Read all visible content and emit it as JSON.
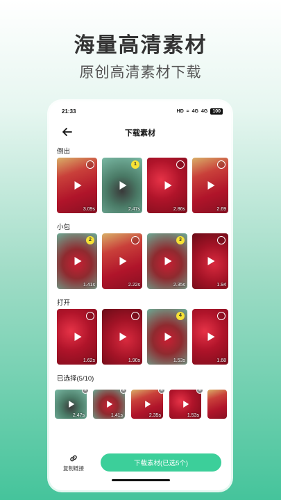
{
  "hero": {
    "title": "海量高清素材",
    "subtitle": "原创高清素材下载"
  },
  "status_bar": {
    "time": "21:33",
    "hd": "HD",
    "wifi": "≈",
    "sig1": "4G",
    "sig2": "4G",
    "battery": "100"
  },
  "nav": {
    "title": "下载素材",
    "back_icon": "arrow-left-icon"
  },
  "sections": [
    {
      "label": "倒出",
      "items": [
        {
          "duration": "3.09s",
          "selected": ""
        },
        {
          "duration": "2.47s",
          "selected": "1"
        },
        {
          "duration": "2.86s",
          "selected": ""
        },
        {
          "duration": "2.69",
          "selected": ""
        }
      ]
    },
    {
      "label": "小包",
      "items": [
        {
          "duration": "1.41s",
          "selected": "2"
        },
        {
          "duration": "2.22s",
          "selected": ""
        },
        {
          "duration": "2.35s",
          "selected": "3"
        },
        {
          "duration": "1.94",
          "selected": ""
        }
      ]
    },
    {
      "label": "打开",
      "items": [
        {
          "duration": "1.62s",
          "selected": ""
        },
        {
          "duration": "1.90s",
          "selected": ""
        },
        {
          "duration": "1.53s",
          "selected": "4"
        },
        {
          "duration": "1.68",
          "selected": ""
        }
      ]
    }
  ],
  "selected": {
    "label": "已选择(5/10)",
    "items": [
      {
        "duration": "2.47s"
      },
      {
        "duration": "1.41s"
      },
      {
        "duration": "2.35s"
      },
      {
        "duration": "1.53s"
      },
      {
        "duration": ""
      }
    ]
  },
  "bottom": {
    "copy_link_label": "复制链接",
    "download_label": "下载素材(已选5个)"
  },
  "colors": {
    "accent": "#3ccf9a",
    "badge": "#f7e234"
  }
}
